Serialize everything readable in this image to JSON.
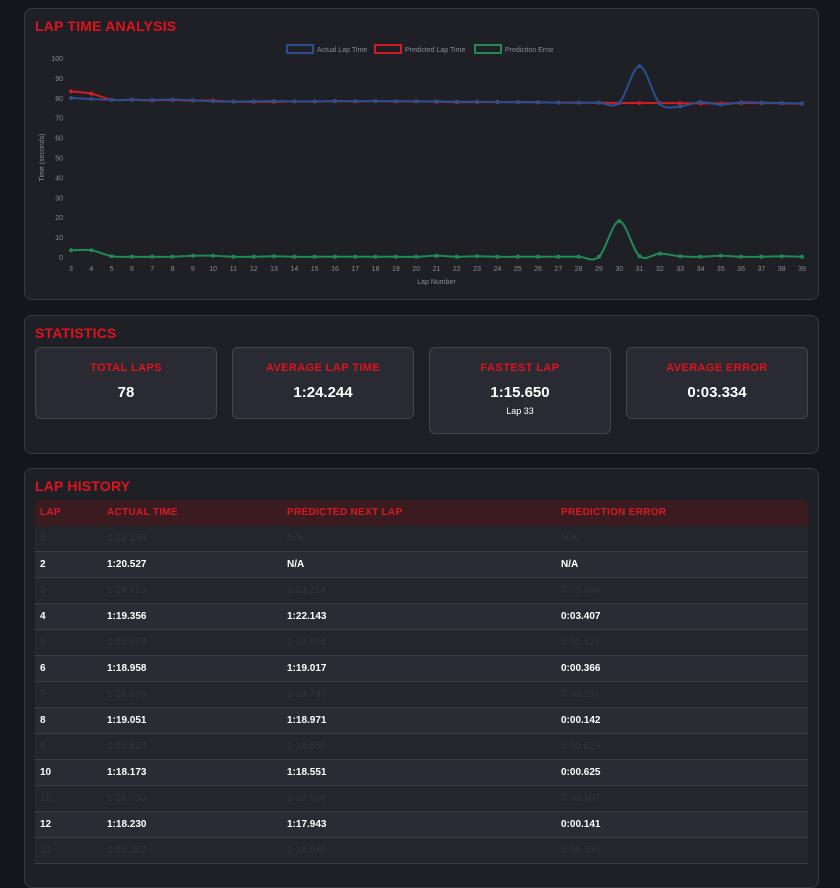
{
  "chart_section": {
    "title": "LAP TIME ANALYSIS"
  },
  "chart_data": {
    "type": "line",
    "xlabel": "Lap Number",
    "ylabel": "Time (seconds)",
    "x": [
      3,
      4,
      5,
      6,
      7,
      8,
      9,
      10,
      11,
      12,
      13,
      14,
      15,
      16,
      17,
      18,
      19,
      20,
      21,
      22,
      23,
      24,
      25,
      26,
      27,
      28,
      29,
      30,
      31,
      32,
      33,
      34,
      35,
      36,
      37,
      38,
      39
    ],
    "ylim": [
      0,
      100
    ],
    "yticks": [
      0,
      10,
      20,
      30,
      40,
      50,
      60,
      70,
      80,
      90,
      100
    ],
    "grid": false,
    "legend_position": "top-center",
    "series": [
      {
        "name": "Actual Lap Time",
        "color": "#2b4f8e",
        "values": [
          79.9,
          79.4,
          78.9,
          79.0,
          78.9,
          79.1,
          78.8,
          78.2,
          78.1,
          78.2,
          78.3,
          78.2,
          78.2,
          78.3,
          78.3,
          78.3,
          78.3,
          78.2,
          78.2,
          78.0,
          78.0,
          77.9,
          77.8,
          77.8,
          77.6,
          77.6,
          77.5,
          77.5,
          95.9,
          77.0,
          75.7,
          77.9,
          76.6,
          77.7,
          77.5,
          77.4,
          77.2
        ]
      },
      {
        "name": "Predicted Lap Time",
        "color": "#cf1b26",
        "values": [
          83.2,
          82.1,
          79.0,
          79.0,
          78.7,
          78.9,
          78.6,
          78.6,
          78.0,
          78.0,
          78.0,
          78.2,
          78.1,
          78.3,
          78.2,
          78.3,
          78.2,
          78.2,
          78.0,
          77.8,
          77.9,
          77.8,
          77.8,
          77.7,
          77.6,
          77.5,
          77.5,
          77.4,
          77.4,
          77.4,
          77.3,
          77.2,
          77.2,
          77.3,
          77.3,
          77.2,
          77.1
        ]
      },
      {
        "name": "Prediction Error",
        "color": "#1f8a52",
        "values": [
          3.4,
          3.4,
          0.4,
          0.1,
          0.1,
          0.1,
          0.6,
          0.6,
          0.1,
          0.1,
          0.4,
          0.1,
          0.1,
          0.1,
          0.1,
          0.1,
          0.1,
          0.1,
          0.6,
          0.1,
          0.4,
          0.1,
          0.1,
          0.1,
          0.1,
          0.1,
          0.1,
          18.0,
          0.4,
          1.7,
          0.4,
          0.1,
          0.6,
          0.1,
          0.1,
          0.4,
          0.1
        ]
      }
    ]
  },
  "stats_section": {
    "title": "STATISTICS",
    "cards": [
      {
        "label": "TOTAL LAPS",
        "value": "78"
      },
      {
        "label": "AVERAGE LAP TIME",
        "value": "1:24.244"
      },
      {
        "label": "FASTEST LAP",
        "value": "1:15.650",
        "sub": "Lap 33"
      },
      {
        "label": "AVERAGE ERROR",
        "value": "0:03.334"
      }
    ]
  },
  "history_section": {
    "title": "LAP HISTORY",
    "headers": [
      "LAP",
      "ACTUAL TIME",
      "PREDICTED NEXT LAP",
      "PREDICTION ERROR"
    ],
    "rows": [
      {
        "lap": "1",
        "actual": "1:22.336",
        "predicted": "N/A",
        "error": "N/A"
      },
      {
        "lap": "2",
        "actual": "1:20.527",
        "predicted": "N/A",
        "error": "N/A"
      },
      {
        "lap": "3",
        "actual": "1:19.910",
        "predicted": "1:23.214",
        "error": "0:03.304"
      },
      {
        "lap": "4",
        "actual": "1:19.356",
        "predicted": "1:22.143",
        "error": "0:03.407"
      },
      {
        "lap": "5",
        "actual": "1:18.978",
        "predicted": "1:19.034",
        "error": "0:00.421"
      },
      {
        "lap": "6",
        "actual": "1:18.958",
        "predicted": "1:19.017",
        "error": "0:00.366"
      },
      {
        "lap": "7",
        "actual": "1:18.865",
        "predicted": "1:18.730",
        "error": "0:00.151"
      },
      {
        "lap": "8",
        "actual": "1:19.051",
        "predicted": "1:18.971",
        "error": "0:00.142"
      },
      {
        "lap": "9",
        "actual": "1:18.820",
        "predicted": "1:18.650",
        "error": "0:00.623"
      },
      {
        "lap": "10",
        "actual": "1:18.173",
        "predicted": "1:18.551",
        "error": "0:00.625"
      },
      {
        "lap": "11",
        "actual": "1:18.050",
        "predicted": "1:18.016",
        "error": "0:00.107"
      },
      {
        "lap": "12",
        "actual": "1:18.230",
        "predicted": "1:17.943",
        "error": "0:00.141"
      },
      {
        "lap": "13",
        "actual": "1:18.282",
        "predicted": "1:18.040",
        "error": "0:00.390"
      }
    ]
  }
}
